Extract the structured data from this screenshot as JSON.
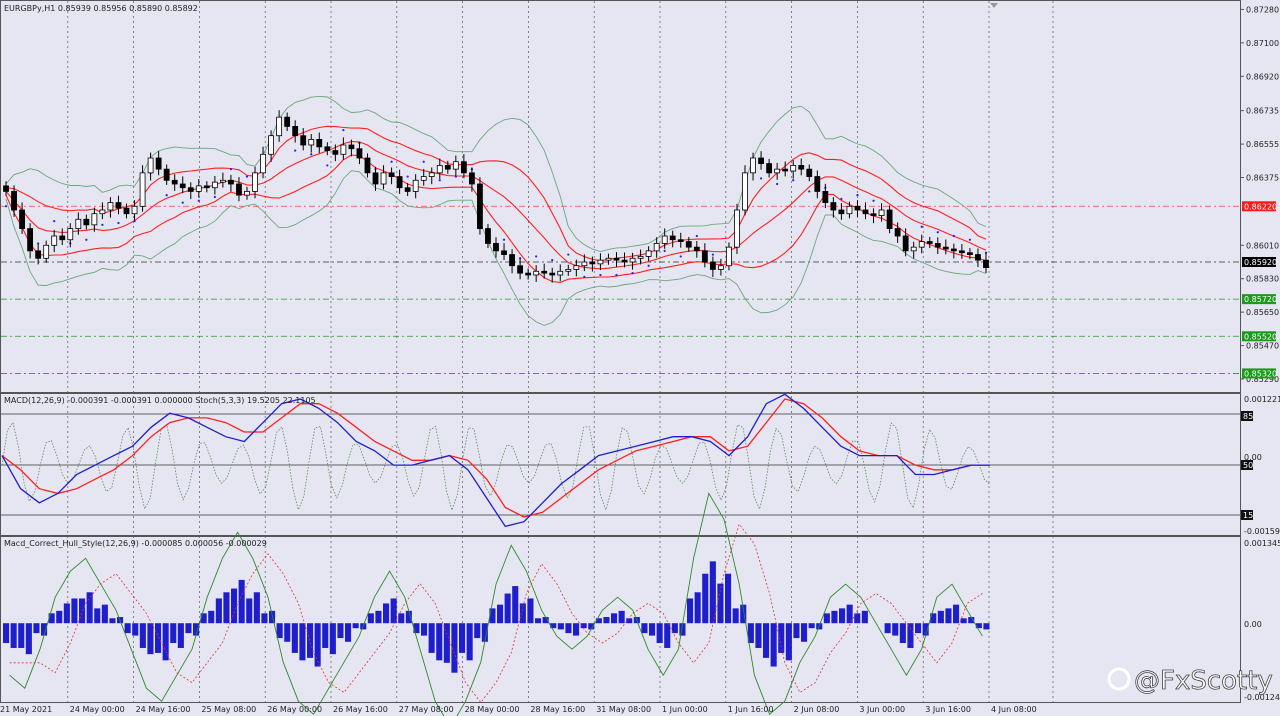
{
  "watermark": "@FxScotty",
  "main_panel": {
    "header": "EURGBPy,H1  0.85939 0.85956 0.85890 0.85892",
    "price_ticks": [
      "0.87280",
      "0.87100",
      "0.86920",
      "0.86735",
      "0.86555",
      "0.86375",
      "0.86010",
      "0.85830",
      "0.85650",
      "0.85470",
      "0.85290"
    ],
    "price_markers": [
      {
        "text": "0.86220",
        "color": "#ff1a1a"
      },
      {
        "text": "0.85920",
        "color": "#000000"
      },
      {
        "text": "0.85720",
        "color": "#1a9a1a"
      },
      {
        "text": "0.85520",
        "color": "#1a9a1a"
      },
      {
        "text": "0.85320",
        "color": "#1a9a1a"
      }
    ]
  },
  "macd_panel": {
    "header": "MACD(12,26,9) -0.000391 -0.000391 0.000000  Stoch(5,3,3) 19.5205 22.1105",
    "ticks": [
      "0.001221",
      "0.00",
      "-0.001597"
    ],
    "stoch_levels": [
      "85",
      "50",
      "15"
    ]
  },
  "hull_panel": {
    "header": "Macd_Correct_Hull_Style(12,26,9) -0.000085 0.000056 -0.000029",
    "ticks": [
      "0.001345",
      "0.00",
      "-0.001241"
    ]
  },
  "time_axis": [
    "21 May 2021",
    "24 May 00:00",
    "24 May 16:00",
    "25 May 08:00",
    "26 May 00:00",
    "26 May 16:00",
    "27 May 08:00",
    "28 May 00:00",
    "28 May 16:00",
    "31 May 08:00",
    "1 Jun 00:00",
    "1 Jun 16:00",
    "2 Jun 08:00",
    "3 Jun 00:00",
    "3 Jun 16:00",
    "4 Jun 08:00"
  ],
  "colors": {
    "background": "#e6e6f2",
    "candle_up": "#ffffff",
    "candle_down": "#000000",
    "bollinger": "#6aa87a",
    "envelope": "#ff2020",
    "sar": "#1e1eff",
    "macd": "#1e1ecc",
    "signal": "#ff2020",
    "stoch": "#5a8a5a",
    "hist": "#1e1ecc"
  },
  "chart_data": [
    {
      "type": "candlestick",
      "title": "EURGBPy,H1",
      "y_unit": "price",
      "ylim": [
        0.8522,
        0.8732
      ],
      "close": [
        0.863,
        0.862,
        0.861,
        0.8598,
        0.8594,
        0.8601,
        0.8606,
        0.8604,
        0.861,
        0.8615,
        0.8612,
        0.8618,
        0.862,
        0.8624,
        0.8621,
        0.8618,
        0.8622,
        0.864,
        0.8648,
        0.8642,
        0.8636,
        0.8634,
        0.8632,
        0.863,
        0.8633,
        0.8632,
        0.8635,
        0.8636,
        0.8634,
        0.8628,
        0.863,
        0.864,
        0.865,
        0.866,
        0.867,
        0.8665,
        0.866,
        0.8655,
        0.8658,
        0.8654,
        0.8652,
        0.865,
        0.8655,
        0.8653,
        0.8648,
        0.864,
        0.8634,
        0.864,
        0.8638,
        0.8632,
        0.863,
        0.8636,
        0.8638,
        0.864,
        0.8644,
        0.8642,
        0.8646,
        0.864,
        0.8634,
        0.861,
        0.8602,
        0.8598,
        0.8596,
        0.859,
        0.8586,
        0.8585,
        0.8587,
        0.8586,
        0.8585,
        0.8587,
        0.8588,
        0.859,
        0.8592,
        0.8591,
        0.8593,
        0.8594,
        0.8593,
        0.8592,
        0.8594,
        0.8595,
        0.8598,
        0.8602,
        0.8606,
        0.8604,
        0.8603,
        0.86,
        0.8598,
        0.8592,
        0.8588,
        0.859,
        0.86,
        0.862,
        0.864,
        0.8648,
        0.8645,
        0.864,
        0.8642,
        0.8641,
        0.8644,
        0.8642,
        0.8638,
        0.863,
        0.8624,
        0.862,
        0.8618,
        0.8622,
        0.862,
        0.8618,
        0.8617,
        0.862,
        0.861,
        0.8606,
        0.8598,
        0.86,
        0.8603,
        0.8602,
        0.86,
        0.8599,
        0.8598,
        0.8597,
        0.8596,
        0.8593,
        0.8589
      ],
      "x_labels": [
        "21 May 2021",
        "24 May 00:00",
        "24 May 16:00",
        "25 May 08:00",
        "26 May 00:00",
        "26 May 16:00",
        "27 May 08:00",
        "28 May 00:00",
        "28 May 16:00",
        "31 May 08:00",
        "1 Jun 00:00",
        "1 Jun 16:00",
        "2 Jun 08:00",
        "3 Jun 00:00",
        "3 Jun 16:00",
        "4 Jun 08:00"
      ],
      "horizontal_lines": [
        0.8622,
        0.8592,
        0.8572,
        0.8552,
        0.8532
      ]
    },
    {
      "type": "line",
      "title": "MACD(12,26,9) / Stoch(5,3,3)",
      "series": [
        {
          "name": "MACD",
          "values": [
            0.0,
            -0.0007,
            -0.001,
            -0.0008,
            -0.0004,
            -0.0002,
            0.0,
            0.0002,
            0.0006,
            0.0009,
            0.0008,
            0.0006,
            0.0004,
            0.0003,
            0.0007,
            0.0011,
            0.0012,
            0.001,
            0.0007,
            0.0003,
            0.0001,
            -0.0002,
            -0.0002,
            -0.0001,
            0.0,
            -0.0003,
            -0.0009,
            -0.0015,
            -0.0014,
            -0.001,
            -0.0006,
            -0.0003,
            0.0,
            0.0001,
            0.0002,
            0.0003,
            0.0004,
            0.0004,
            0.0003,
            0.0,
            0.0004,
            0.0011,
            0.0013,
            0.001,
            0.0006,
            0.0002,
            0.0,
            0.0,
            0.0,
            -0.0004,
            -0.0004,
            -0.0003,
            -0.0002,
            -0.0002
          ]
        },
        {
          "name": "Signal",
          "values": [
            0.0,
            -0.0003,
            -0.0007,
            -0.0008,
            -0.0007,
            -0.0005,
            -0.0003,
            0.0,
            0.0004,
            0.0007,
            0.0008,
            0.0008,
            0.0007,
            0.0005,
            0.0005,
            0.0008,
            0.0011,
            0.0011,
            0.0009,
            0.0006,
            0.0003,
            0.0001,
            -0.0001,
            -0.0001,
            0.0,
            -0.0001,
            -0.0005,
            -0.0011,
            -0.0013,
            -0.0012,
            -0.0009,
            -0.0006,
            -0.0003,
            -0.0001,
            0.0001,
            0.0002,
            0.0003,
            0.0004,
            0.0004,
            0.0001,
            0.0002,
            0.0007,
            0.0012,
            0.0011,
            0.0008,
            0.0004,
            0.0001,
            0.0,
            0.0,
            -0.0002,
            -0.0003,
            -0.0003,
            -0.0002,
            -0.0002
          ]
        }
      ],
      "ylim": [
        -0.001597,
        0.001221
      ]
    },
    {
      "type": "bar",
      "title": "Macd_Correct_Hull_Style(12,26,9)",
      "values": [
        -0.0004,
        -0.0005,
        -0.0002,
        0.0002,
        0.0004,
        0.0005,
        0.0003,
        0.0001,
        -0.0002,
        -0.0005,
        -0.0006,
        -0.0004,
        -0.0002,
        0.0002,
        0.0005,
        0.0007,
        0.0005,
        0.0002,
        -0.0003,
        -0.0006,
        -0.0007,
        -0.0005,
        -0.0003,
        -0.0001,
        0.0002,
        0.0004,
        0.0002,
        -0.0002,
        -0.0006,
        -0.0008,
        -0.0006,
        -0.0003,
        0.0003,
        0.0006,
        0.0004,
        0.0001,
        -0.0001,
        -0.0002,
        -0.0001,
        0.0001,
        0.0002,
        0.0001,
        -0.0002,
        -0.0004,
        -0.0002,
        0.0005,
        0.001,
        0.0008,
        0.0003,
        -0.0004,
        -0.0007,
        -0.0006,
        -0.0003,
        -0.0001,
        0.0002,
        0.0003,
        0.0002,
        0.0,
        -0.0002,
        -0.0004,
        -0.0002,
        0.0002,
        0.0003,
        0.0001,
        -0.0001
      ],
      "ylim": [
        -0.001241,
        0.001345
      ]
    }
  ]
}
